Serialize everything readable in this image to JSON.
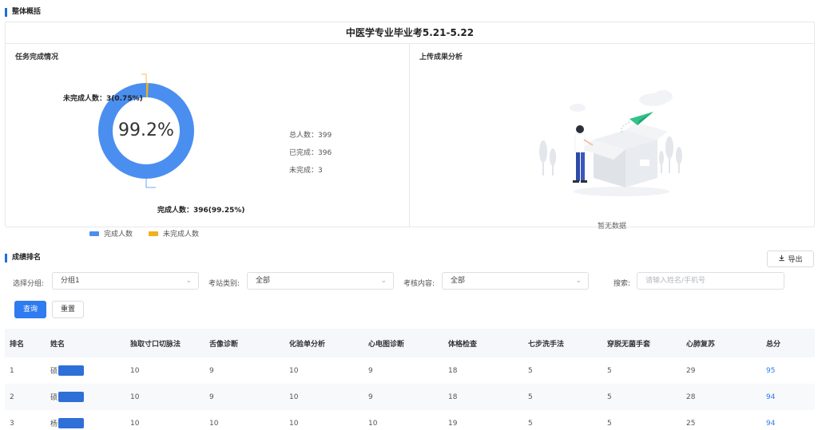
{
  "overview": {
    "section_title": "整体概括",
    "exam_title": "中医学专业毕业考5.21-5.22",
    "task_panel": {
      "title": "任务完成情况",
      "center_percent": "99.2%",
      "completed_fraction": 0.9925,
      "uncompleted_callout": "未完成人数：3(0.75%)",
      "completed_callout": "完成人数：396(99.25%)",
      "stats": {
        "total": "总人数：399",
        "done": "已完成：396",
        "undone": "未完成：3"
      },
      "legend": {
        "completed": "完成人数",
        "uncompleted": "未完成人数"
      },
      "colors": {
        "completed": "#4a8ff0",
        "uncompleted": "#f2b01e"
      }
    },
    "upload_panel": {
      "title": "上传成果分析",
      "empty_text": "暂无数据"
    }
  },
  "ranking": {
    "section_title": "成绩排名",
    "export_label": "导出",
    "filters": {
      "group_label": "选择分组:",
      "group_value": "分组1",
      "station_label": "考站类别:",
      "station_value": "全部",
      "content_label": "考核内容:",
      "content_value": "全部",
      "search_label": "搜索:",
      "search_placeholder": "请输入姓名/手机号"
    },
    "buttons": {
      "query": "查询",
      "reset": "重置"
    },
    "columns": [
      "排名",
      "姓名",
      "独取寸口切脉法",
      "舌像诊断",
      "化验单分析",
      "心电图诊断",
      "体格检查",
      "七步洗手法",
      "穿脱无菌手套",
      "心肺复苏",
      "总分"
    ],
    "rows": [
      {
        "rank": "1",
        "name": "硕",
        "c1": "10",
        "c2": "9",
        "c3": "10",
        "c4": "9",
        "c5": "18",
        "c6": "5",
        "c7": "5",
        "c8": "29",
        "total": "95"
      },
      {
        "rank": "2",
        "name": "硕",
        "c1": "10",
        "c2": "9",
        "c3": "10",
        "c4": "9",
        "c5": "18",
        "c6": "5",
        "c7": "5",
        "c8": "28",
        "total": "94"
      },
      {
        "rank": "3",
        "name": "杨",
        "c1": "10",
        "c2": "10",
        "c3": "10",
        "c4": "10",
        "c5": "19",
        "c6": "5",
        "c7": "5",
        "c8": "25",
        "total": "94"
      }
    ]
  }
}
